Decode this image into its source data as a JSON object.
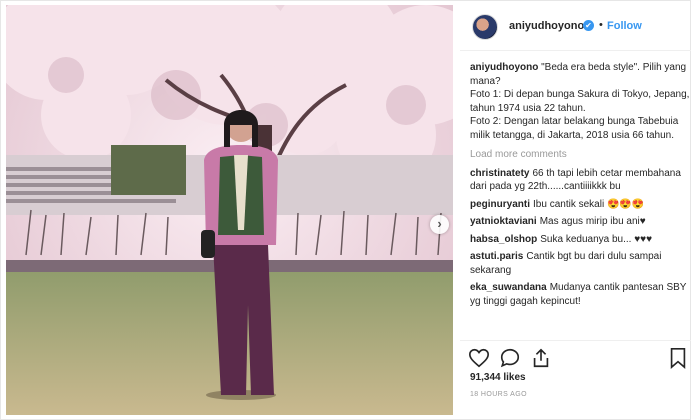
{
  "post": {
    "username": "aniyudhoyono",
    "verified_mark": "✔",
    "separator": "•",
    "follow_label": "Follow",
    "caption_user": "aniyudhoyono",
    "caption_text": "\"Beda era beda style\". Pilih yang mana?\nFoto 1: Di depan bunga Sakura di Tokyo, Jepang, tahun 1974 usia 22 tahun.\nFoto 2: Dengan latar belakang bunga Tabebuia milik tetangga, di Jakarta, 2018 usia 66 tahun.",
    "load_more": "Load more comments",
    "comments": [
      {
        "user": "christinatety",
        "text": "66 th tapi lebih cetar membahana dari pada yg 22th......cantiiiikkk bu"
      },
      {
        "user": "peginuryanti",
        "text": "Ibu cantik sekali 😍😍😍"
      },
      {
        "user": "yatnioktaviani",
        "text": "Mas agus mirip ibu ani♥"
      },
      {
        "user": "habsa_olshop",
        "text": "Suka keduanya bu... ♥♥♥"
      },
      {
        "user": "astuti.paris",
        "text": "Cantik bgt bu dari dulu sampai sekarang"
      },
      {
        "user": "eka_suwandana",
        "text": "Mudanya cantik pantesan SBY yg tinggi gagah kepincut!"
      }
    ],
    "next_arrow": "›",
    "likes": "91,344 likes",
    "time": "18 HOURS AGO"
  },
  "icons": {
    "avatar": "avatar-icon",
    "heart": "heart-icon",
    "comment": "comment-icon",
    "share": "share-icon",
    "bookmark": "bookmark-icon"
  },
  "colors": {
    "link_blue": "#3897f0",
    "muted": "#999999",
    "text": "#262626"
  }
}
